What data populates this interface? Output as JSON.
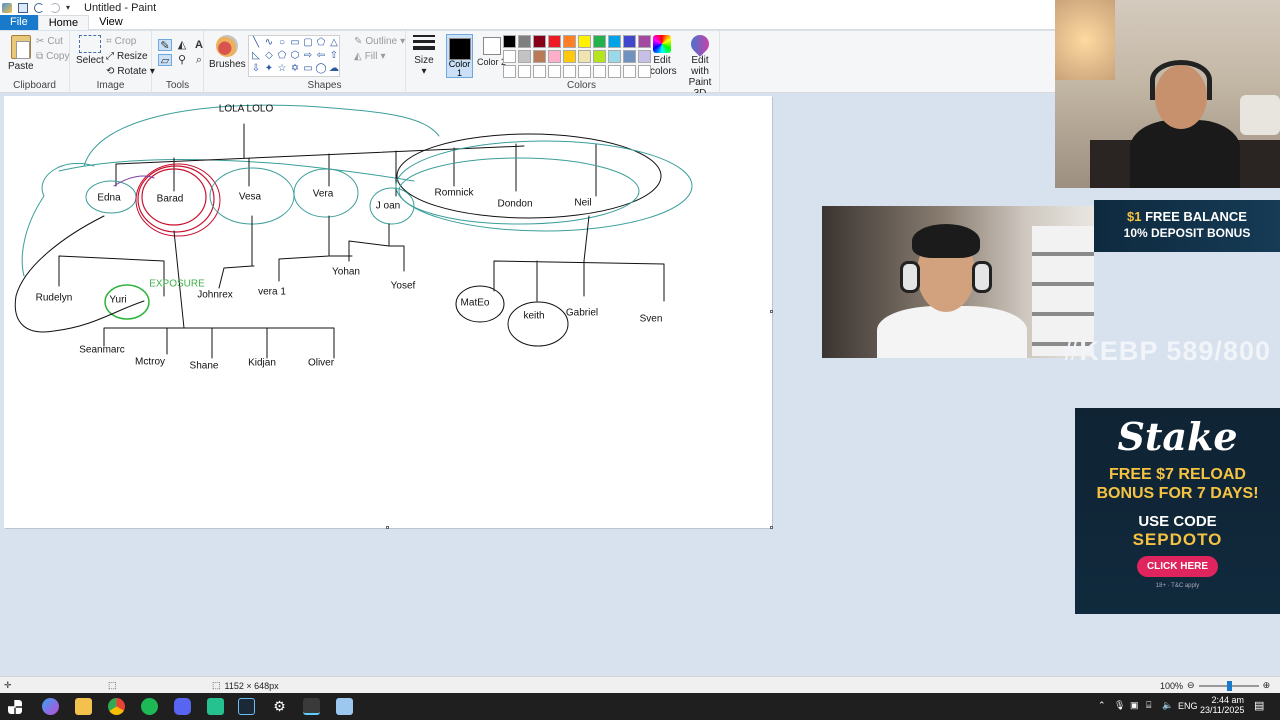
{
  "window": {
    "title": "Untitled - Paint"
  },
  "tabs": [
    {
      "label": "File"
    },
    {
      "label": "Home"
    },
    {
      "label": "View"
    }
  ],
  "ribbon": {
    "clipboard": {
      "label": "Clipboard",
      "paste": "Paste",
      "cut": "Cut",
      "copy": "Copy"
    },
    "image": {
      "label": "Image",
      "select": "Select",
      "crop": "Crop",
      "resize": "Resize",
      "rotate": "Rotate"
    },
    "tools": {
      "label": "Tools"
    },
    "brushes": {
      "label": "Brushes"
    },
    "shapes": {
      "label": "Shapes",
      "outline": "Outline",
      "fill": "Fill"
    },
    "size": {
      "label": "Size"
    },
    "colors": {
      "label": "Colors",
      "color1": "Color 1",
      "color2": "Color 2",
      "edit_colors": "Edit colors",
      "edit_paint3d": "Edit with Paint 3D",
      "palette_row1": [
        "#000000",
        "#7f7f7f",
        "#880015",
        "#ed1c24",
        "#ff7f27",
        "#fff200",
        "#22b14c",
        "#00a2e8",
        "#3f48cc",
        "#a349a4"
      ],
      "palette_row2": [
        "#ffffff",
        "#c3c3c3",
        "#b97a57",
        "#ffaec9",
        "#ffc90e",
        "#efe4b0",
        "#b5e61d",
        "#99d9ea",
        "#7092be",
        "#c8bfe7"
      ],
      "palette_row3": [
        "#ffffff",
        "#ffffff",
        "#ffffff",
        "#ffffff",
        "#ffffff",
        "#ffffff",
        "#ffffff",
        "#ffffff",
        "#ffffff",
        "#ffffff"
      ]
    }
  },
  "canvas": {
    "labels": [
      {
        "text": "LOLA LOLO",
        "color": "black"
      },
      {
        "text": "Edna",
        "color": "black"
      },
      {
        "text": "Barad",
        "color": "black"
      },
      {
        "text": "Vesa",
        "color": "black"
      },
      {
        "text": "Vera",
        "color": "black"
      },
      {
        "text": "J oan",
        "color": "black"
      },
      {
        "text": "Romnick",
        "color": "black"
      },
      {
        "text": "Dondon",
        "color": "black"
      },
      {
        "text": "Neil",
        "color": "black"
      },
      {
        "text": "Rudelyn",
        "color": "black"
      },
      {
        "text": "Yuri",
        "color": "black"
      },
      {
        "text": "EXPOSURE",
        "color": "green"
      },
      {
        "text": "Johnrex",
        "color": "black"
      },
      {
        "text": "vera 1",
        "color": "black"
      },
      {
        "text": "Yohan",
        "color": "black"
      },
      {
        "text": "Yosef",
        "color": "black"
      },
      {
        "text": "MatEo",
        "color": "black"
      },
      {
        "text": "keith",
        "color": "black"
      },
      {
        "text": "Gabriel",
        "color": "black"
      },
      {
        "text": "Sven",
        "color": "black"
      },
      {
        "text": "Seanmarc",
        "color": "black"
      },
      {
        "text": "Mctroy",
        "color": "black"
      },
      {
        "text": "Shane",
        "color": "black"
      },
      {
        "text": "Kidjan",
        "color": "black"
      },
      {
        "text": "Oliver",
        "color": "black"
      }
    ]
  },
  "statusbar": {
    "dimensions": "1152 × 648px",
    "zoom": "100%"
  },
  "taskbar": {
    "lang": "ENG",
    "time": "2:44 am",
    "date": "23/11/2025"
  },
  "overlays": {
    "promo1": {
      "line1_a": "$1",
      "line1_b": " FREE BALANCE",
      "line2": "10% DEPOSIT BONUS"
    },
    "counter": "#KEBP 589/800",
    "stake": {
      "logo": "Stake",
      "promo_line1": "FREE $7 RELOAD",
      "promo_line2": "BONUS FOR 7 DAYS!",
      "code_label": "USE CODE",
      "code": "SEPDOTO",
      "cta": "CLICK HERE",
      "fine": "18+ · T&C apply"
    }
  }
}
